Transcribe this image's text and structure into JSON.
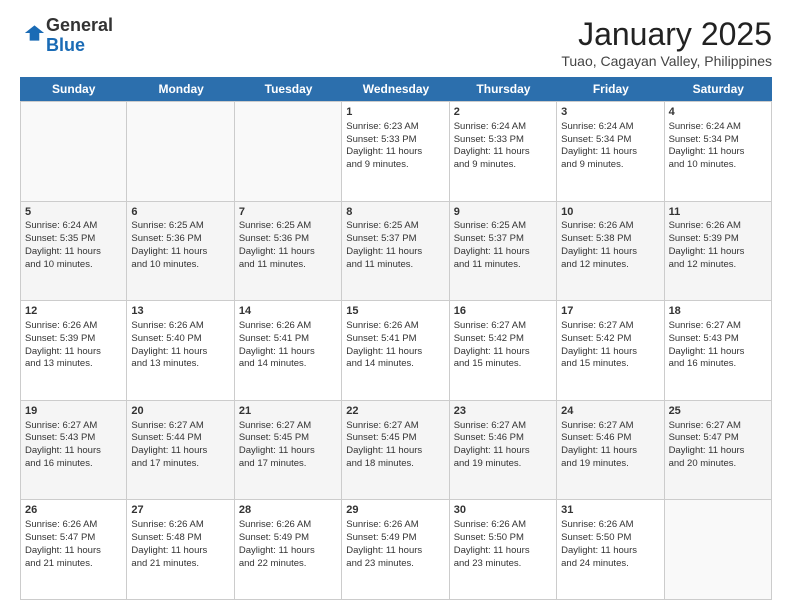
{
  "logo": {
    "line1": "General",
    "line2": "Blue"
  },
  "title": "January 2025",
  "location": "Tuao, Cagayan Valley, Philippines",
  "weekdays": [
    "Sunday",
    "Monday",
    "Tuesday",
    "Wednesday",
    "Thursday",
    "Friday",
    "Saturday"
  ],
  "rows": [
    [
      {
        "day": "",
        "lines": []
      },
      {
        "day": "",
        "lines": []
      },
      {
        "day": "",
        "lines": []
      },
      {
        "day": "1",
        "lines": [
          "Sunrise: 6:23 AM",
          "Sunset: 5:33 PM",
          "Daylight: 11 hours",
          "and 9 minutes."
        ]
      },
      {
        "day": "2",
        "lines": [
          "Sunrise: 6:24 AM",
          "Sunset: 5:33 PM",
          "Daylight: 11 hours",
          "and 9 minutes."
        ]
      },
      {
        "day": "3",
        "lines": [
          "Sunrise: 6:24 AM",
          "Sunset: 5:34 PM",
          "Daylight: 11 hours",
          "and 9 minutes."
        ]
      },
      {
        "day": "4",
        "lines": [
          "Sunrise: 6:24 AM",
          "Sunset: 5:34 PM",
          "Daylight: 11 hours",
          "and 10 minutes."
        ]
      }
    ],
    [
      {
        "day": "5",
        "lines": [
          "Sunrise: 6:24 AM",
          "Sunset: 5:35 PM",
          "Daylight: 11 hours",
          "and 10 minutes."
        ]
      },
      {
        "day": "6",
        "lines": [
          "Sunrise: 6:25 AM",
          "Sunset: 5:36 PM",
          "Daylight: 11 hours",
          "and 10 minutes."
        ]
      },
      {
        "day": "7",
        "lines": [
          "Sunrise: 6:25 AM",
          "Sunset: 5:36 PM",
          "Daylight: 11 hours",
          "and 11 minutes."
        ]
      },
      {
        "day": "8",
        "lines": [
          "Sunrise: 6:25 AM",
          "Sunset: 5:37 PM",
          "Daylight: 11 hours",
          "and 11 minutes."
        ]
      },
      {
        "day": "9",
        "lines": [
          "Sunrise: 6:25 AM",
          "Sunset: 5:37 PM",
          "Daylight: 11 hours",
          "and 11 minutes."
        ]
      },
      {
        "day": "10",
        "lines": [
          "Sunrise: 6:26 AM",
          "Sunset: 5:38 PM",
          "Daylight: 11 hours",
          "and 12 minutes."
        ]
      },
      {
        "day": "11",
        "lines": [
          "Sunrise: 6:26 AM",
          "Sunset: 5:39 PM",
          "Daylight: 11 hours",
          "and 12 minutes."
        ]
      }
    ],
    [
      {
        "day": "12",
        "lines": [
          "Sunrise: 6:26 AM",
          "Sunset: 5:39 PM",
          "Daylight: 11 hours",
          "and 13 minutes."
        ]
      },
      {
        "day": "13",
        "lines": [
          "Sunrise: 6:26 AM",
          "Sunset: 5:40 PM",
          "Daylight: 11 hours",
          "and 13 minutes."
        ]
      },
      {
        "day": "14",
        "lines": [
          "Sunrise: 6:26 AM",
          "Sunset: 5:41 PM",
          "Daylight: 11 hours",
          "and 14 minutes."
        ]
      },
      {
        "day": "15",
        "lines": [
          "Sunrise: 6:26 AM",
          "Sunset: 5:41 PM",
          "Daylight: 11 hours",
          "and 14 minutes."
        ]
      },
      {
        "day": "16",
        "lines": [
          "Sunrise: 6:27 AM",
          "Sunset: 5:42 PM",
          "Daylight: 11 hours",
          "and 15 minutes."
        ]
      },
      {
        "day": "17",
        "lines": [
          "Sunrise: 6:27 AM",
          "Sunset: 5:42 PM",
          "Daylight: 11 hours",
          "and 15 minutes."
        ]
      },
      {
        "day": "18",
        "lines": [
          "Sunrise: 6:27 AM",
          "Sunset: 5:43 PM",
          "Daylight: 11 hours",
          "and 16 minutes."
        ]
      }
    ],
    [
      {
        "day": "19",
        "lines": [
          "Sunrise: 6:27 AM",
          "Sunset: 5:43 PM",
          "Daylight: 11 hours",
          "and 16 minutes."
        ]
      },
      {
        "day": "20",
        "lines": [
          "Sunrise: 6:27 AM",
          "Sunset: 5:44 PM",
          "Daylight: 11 hours",
          "and 17 minutes."
        ]
      },
      {
        "day": "21",
        "lines": [
          "Sunrise: 6:27 AM",
          "Sunset: 5:45 PM",
          "Daylight: 11 hours",
          "and 17 minutes."
        ]
      },
      {
        "day": "22",
        "lines": [
          "Sunrise: 6:27 AM",
          "Sunset: 5:45 PM",
          "Daylight: 11 hours",
          "and 18 minutes."
        ]
      },
      {
        "day": "23",
        "lines": [
          "Sunrise: 6:27 AM",
          "Sunset: 5:46 PM",
          "Daylight: 11 hours",
          "and 19 minutes."
        ]
      },
      {
        "day": "24",
        "lines": [
          "Sunrise: 6:27 AM",
          "Sunset: 5:46 PM",
          "Daylight: 11 hours",
          "and 19 minutes."
        ]
      },
      {
        "day": "25",
        "lines": [
          "Sunrise: 6:27 AM",
          "Sunset: 5:47 PM",
          "Daylight: 11 hours",
          "and 20 minutes."
        ]
      }
    ],
    [
      {
        "day": "26",
        "lines": [
          "Sunrise: 6:26 AM",
          "Sunset: 5:47 PM",
          "Daylight: 11 hours",
          "and 21 minutes."
        ]
      },
      {
        "day": "27",
        "lines": [
          "Sunrise: 6:26 AM",
          "Sunset: 5:48 PM",
          "Daylight: 11 hours",
          "and 21 minutes."
        ]
      },
      {
        "day": "28",
        "lines": [
          "Sunrise: 6:26 AM",
          "Sunset: 5:49 PM",
          "Daylight: 11 hours",
          "and 22 minutes."
        ]
      },
      {
        "day": "29",
        "lines": [
          "Sunrise: 6:26 AM",
          "Sunset: 5:49 PM",
          "Daylight: 11 hours",
          "and 23 minutes."
        ]
      },
      {
        "day": "30",
        "lines": [
          "Sunrise: 6:26 AM",
          "Sunset: 5:50 PM",
          "Daylight: 11 hours",
          "and 23 minutes."
        ]
      },
      {
        "day": "31",
        "lines": [
          "Sunrise: 6:26 AM",
          "Sunset: 5:50 PM",
          "Daylight: 11 hours",
          "and 24 minutes."
        ]
      },
      {
        "day": "",
        "lines": []
      }
    ]
  ]
}
